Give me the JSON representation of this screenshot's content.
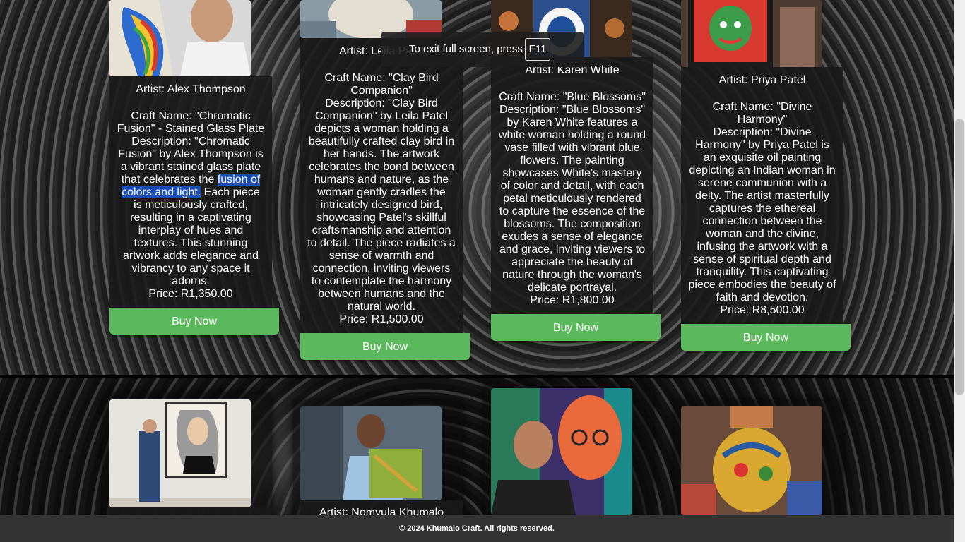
{
  "cards": [
    {
      "artist": "Artist: Alex Thompson",
      "craft": "Craft Name: \"Chromatic Fusion\" - Stained Glass Plate",
      "desc_before": "Description: \"Chromatic Fusion\" by Alex Thompson is a vibrant stained glass plate that celebrates the ",
      "desc_highlight": "fusion of colors and light.",
      "desc_after": " Each piece is meticulously crafted, resulting in a captivating interplay of hues and textures. This stunning artwork adds elegance and vibrancy to any space it adorns.",
      "price": "Price: R1,350.00",
      "buy": "Buy Now"
    },
    {
      "artist": "Artist: Leila Patel",
      "craft": "Craft Name: \"Clay Bird Companion\"",
      "desc": "Description: \"Clay Bird Companion\" by Leila Patel depicts a woman holding a beautifully crafted clay bird in her hands. The artwork celebrates the bond between humans and nature, as the woman gently cradles the intricately designed bird, showcasing Patel's skillful craftsmanship and attention to detail. The piece radiates a sense of warmth and connection, inviting viewers to contemplate the harmony between humans and the natural world.",
      "price": "Price: R1,500.00",
      "buy": "Buy Now"
    },
    {
      "artist": "Artist: Karen White",
      "craft": "Craft Name: \"Blue Blossoms\"",
      "desc": "Description: \"Blue Blossoms\" by Karen White features a white woman holding a round vase filled with vibrant blue flowers. The painting showcases White's mastery of color and detail, with each petal meticulously rendered to capture the essence of the blossoms. The composition exudes a sense of elegance and grace, inviting viewers to appreciate the beauty of nature through the woman's delicate portrayal.",
      "price": "Price: R1,800.00",
      "buy": "Buy Now"
    },
    {
      "artist": "Artist: Priya Patel",
      "craft": "Craft Name: \"Divine Harmony\"",
      "desc": "Description: \"Divine Harmony\" by Priya Patel is an exquisite oil painting depicting an Indian woman in serene communion with a deity. The artist masterfully captures the ethereal connection between the woman and the divine, infusing the artwork with a sense of spiritual depth and tranquility. This captivating piece embodies the beauty of faith and devotion.",
      "price": "Price: R8,500.00",
      "buy": "Buy Now"
    }
  ],
  "lower": {
    "artist2": "Artist: Nomvula Khumalo"
  },
  "fullscreen": {
    "text": "To exit full screen, press",
    "key": "F11"
  },
  "footer": "© 2024 Khumalo Craft. All rights reserved."
}
